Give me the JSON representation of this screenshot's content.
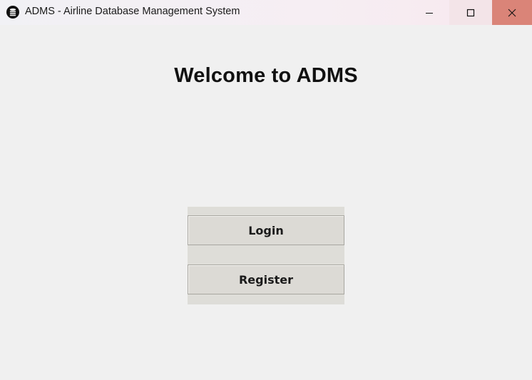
{
  "window": {
    "title": "ADMS - Airline Database Management System",
    "icon": "database-icon",
    "controls": {
      "minimize_icon": "minimize-icon",
      "maximize_icon": "maximize-icon",
      "close_icon": "close-icon",
      "close_hover_color": "#da8478"
    }
  },
  "main": {
    "heading": "Welcome to ADMS",
    "buttons": {
      "login_label": "Login",
      "register_label": "Register"
    }
  },
  "colors": {
    "background": "#f0f0f0",
    "button_face": "#dcdad5",
    "panel": "#deddd8"
  }
}
